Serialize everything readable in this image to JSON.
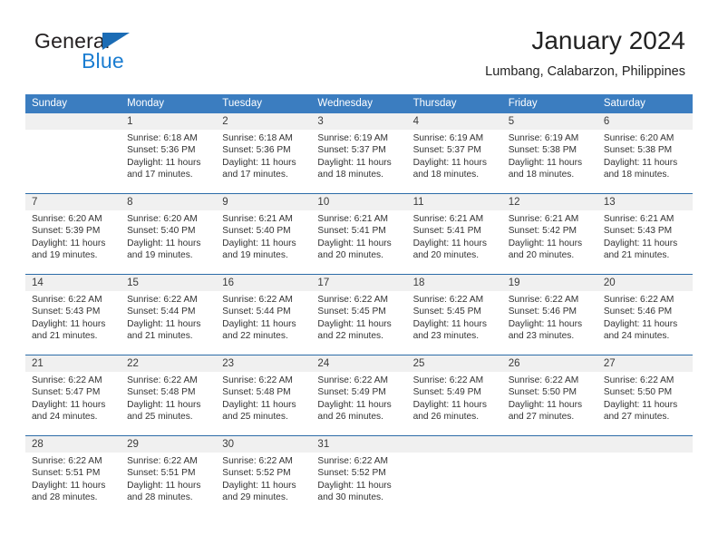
{
  "brand": {
    "name_top": "General",
    "name_bottom": "Blue",
    "color_dark": "#231f20",
    "color_blue": "#1b7dd1",
    "triangle_color": "#1b6cb5"
  },
  "header": {
    "title": "January 2024",
    "subtitle": "Lumbang, Calabarzon, Philippines"
  },
  "theme": {
    "header_row_bg": "#3b7dc0",
    "header_row_text": "#ffffff",
    "week_rule": "#2c6ca8",
    "number_band_bg": "#f0f0f0",
    "body_text": "#333333"
  },
  "calendar": {
    "weekdays": [
      "Sunday",
      "Monday",
      "Tuesday",
      "Wednesday",
      "Thursday",
      "Friday",
      "Saturday"
    ],
    "weeks": [
      [
        {
          "date": "",
          "lines": [
            "",
            "",
            "",
            ""
          ]
        },
        {
          "date": "1",
          "lines": [
            "Sunrise: 6:18 AM",
            "Sunset: 5:36 PM",
            "Daylight: 11 hours",
            "and 17 minutes."
          ]
        },
        {
          "date": "2",
          "lines": [
            "Sunrise: 6:18 AM",
            "Sunset: 5:36 PM",
            "Daylight: 11 hours",
            "and 17 minutes."
          ]
        },
        {
          "date": "3",
          "lines": [
            "Sunrise: 6:19 AM",
            "Sunset: 5:37 PM",
            "Daylight: 11 hours",
            "and 18 minutes."
          ]
        },
        {
          "date": "4",
          "lines": [
            "Sunrise: 6:19 AM",
            "Sunset: 5:37 PM",
            "Daylight: 11 hours",
            "and 18 minutes."
          ]
        },
        {
          "date": "5",
          "lines": [
            "Sunrise: 6:19 AM",
            "Sunset: 5:38 PM",
            "Daylight: 11 hours",
            "and 18 minutes."
          ]
        },
        {
          "date": "6",
          "lines": [
            "Sunrise: 6:20 AM",
            "Sunset: 5:38 PM",
            "Daylight: 11 hours",
            "and 18 minutes."
          ]
        }
      ],
      [
        {
          "date": "7",
          "lines": [
            "Sunrise: 6:20 AM",
            "Sunset: 5:39 PM",
            "Daylight: 11 hours",
            "and 19 minutes."
          ]
        },
        {
          "date": "8",
          "lines": [
            "Sunrise: 6:20 AM",
            "Sunset: 5:40 PM",
            "Daylight: 11 hours",
            "and 19 minutes."
          ]
        },
        {
          "date": "9",
          "lines": [
            "Sunrise: 6:21 AM",
            "Sunset: 5:40 PM",
            "Daylight: 11 hours",
            "and 19 minutes."
          ]
        },
        {
          "date": "10",
          "lines": [
            "Sunrise: 6:21 AM",
            "Sunset: 5:41 PM",
            "Daylight: 11 hours",
            "and 20 minutes."
          ]
        },
        {
          "date": "11",
          "lines": [
            "Sunrise: 6:21 AM",
            "Sunset: 5:41 PM",
            "Daylight: 11 hours",
            "and 20 minutes."
          ]
        },
        {
          "date": "12",
          "lines": [
            "Sunrise: 6:21 AM",
            "Sunset: 5:42 PM",
            "Daylight: 11 hours",
            "and 20 minutes."
          ]
        },
        {
          "date": "13",
          "lines": [
            "Sunrise: 6:21 AM",
            "Sunset: 5:43 PM",
            "Daylight: 11 hours",
            "and 21 minutes."
          ]
        }
      ],
      [
        {
          "date": "14",
          "lines": [
            "Sunrise: 6:22 AM",
            "Sunset: 5:43 PM",
            "Daylight: 11 hours",
            "and 21 minutes."
          ]
        },
        {
          "date": "15",
          "lines": [
            "Sunrise: 6:22 AM",
            "Sunset: 5:44 PM",
            "Daylight: 11 hours",
            "and 21 minutes."
          ]
        },
        {
          "date": "16",
          "lines": [
            "Sunrise: 6:22 AM",
            "Sunset: 5:44 PM",
            "Daylight: 11 hours",
            "and 22 minutes."
          ]
        },
        {
          "date": "17",
          "lines": [
            "Sunrise: 6:22 AM",
            "Sunset: 5:45 PM",
            "Daylight: 11 hours",
            "and 22 minutes."
          ]
        },
        {
          "date": "18",
          "lines": [
            "Sunrise: 6:22 AM",
            "Sunset: 5:45 PM",
            "Daylight: 11 hours",
            "and 23 minutes."
          ]
        },
        {
          "date": "19",
          "lines": [
            "Sunrise: 6:22 AM",
            "Sunset: 5:46 PM",
            "Daylight: 11 hours",
            "and 23 minutes."
          ]
        },
        {
          "date": "20",
          "lines": [
            "Sunrise: 6:22 AM",
            "Sunset: 5:46 PM",
            "Daylight: 11 hours",
            "and 24 minutes."
          ]
        }
      ],
      [
        {
          "date": "21",
          "lines": [
            "Sunrise: 6:22 AM",
            "Sunset: 5:47 PM",
            "Daylight: 11 hours",
            "and 24 minutes."
          ]
        },
        {
          "date": "22",
          "lines": [
            "Sunrise: 6:22 AM",
            "Sunset: 5:48 PM",
            "Daylight: 11 hours",
            "and 25 minutes."
          ]
        },
        {
          "date": "23",
          "lines": [
            "Sunrise: 6:22 AM",
            "Sunset: 5:48 PM",
            "Daylight: 11 hours",
            "and 25 minutes."
          ]
        },
        {
          "date": "24",
          "lines": [
            "Sunrise: 6:22 AM",
            "Sunset: 5:49 PM",
            "Daylight: 11 hours",
            "and 26 minutes."
          ]
        },
        {
          "date": "25",
          "lines": [
            "Sunrise: 6:22 AM",
            "Sunset: 5:49 PM",
            "Daylight: 11 hours",
            "and 26 minutes."
          ]
        },
        {
          "date": "26",
          "lines": [
            "Sunrise: 6:22 AM",
            "Sunset: 5:50 PM",
            "Daylight: 11 hours",
            "and 27 minutes."
          ]
        },
        {
          "date": "27",
          "lines": [
            "Sunrise: 6:22 AM",
            "Sunset: 5:50 PM",
            "Daylight: 11 hours",
            "and 27 minutes."
          ]
        }
      ],
      [
        {
          "date": "28",
          "lines": [
            "Sunrise: 6:22 AM",
            "Sunset: 5:51 PM",
            "Daylight: 11 hours",
            "and 28 minutes."
          ]
        },
        {
          "date": "29",
          "lines": [
            "Sunrise: 6:22 AM",
            "Sunset: 5:51 PM",
            "Daylight: 11 hours",
            "and 28 minutes."
          ]
        },
        {
          "date": "30",
          "lines": [
            "Sunrise: 6:22 AM",
            "Sunset: 5:52 PM",
            "Daylight: 11 hours",
            "and 29 minutes."
          ]
        },
        {
          "date": "31",
          "lines": [
            "Sunrise: 6:22 AM",
            "Sunset: 5:52 PM",
            "Daylight: 11 hours",
            "and 30 minutes."
          ]
        },
        {
          "date": "",
          "lines": [
            "",
            "",
            "",
            ""
          ]
        },
        {
          "date": "",
          "lines": [
            "",
            "",
            "",
            ""
          ]
        },
        {
          "date": "",
          "lines": [
            "",
            "",
            "",
            ""
          ]
        }
      ]
    ]
  }
}
